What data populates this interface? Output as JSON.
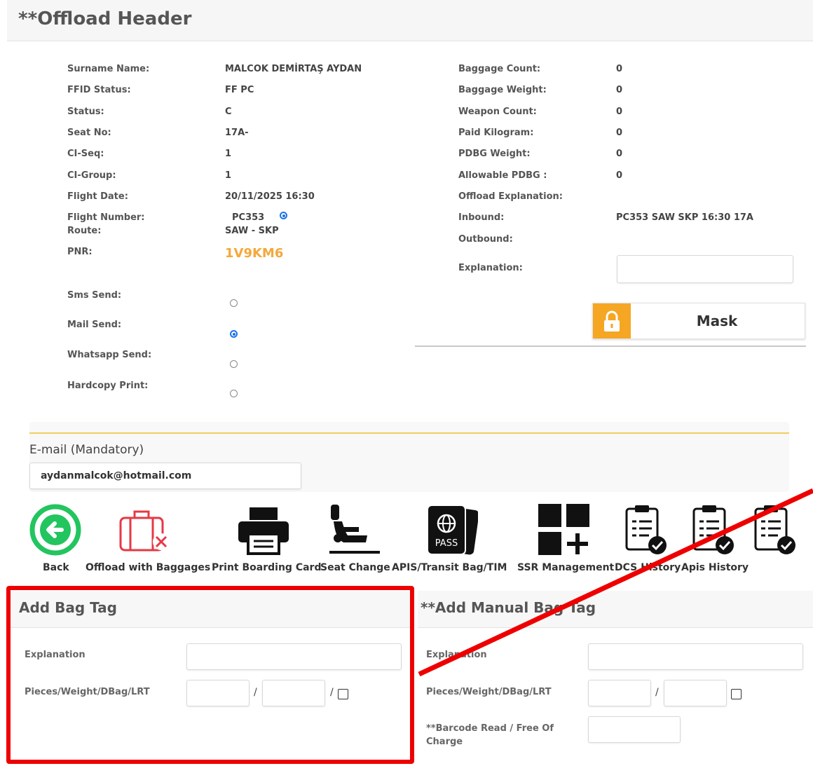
{
  "header": {
    "title": "**Offload Header"
  },
  "passenger_left": [
    {
      "label": "Surname Name:",
      "value": "MALCOK DEMİRTAŞ AYDAN"
    },
    {
      "label": "FFID Status:",
      "value": "FF PC"
    },
    {
      "label": "Status:",
      "value": "C"
    },
    {
      "label": "Seat No:",
      "value": "17A-"
    },
    {
      "label": "CI-Seq:",
      "value": "1"
    },
    {
      "label": "CI-Group:",
      "value": "1"
    },
    {
      "label": "Flight Date:",
      "value": "20/11/2025 16:30"
    },
    {
      "label": "Flight Number:",
      "value": "PC353"
    },
    {
      "label": "Route:",
      "value": "SAW - SKP"
    },
    {
      "label": "PNR:",
      "value": "1V9KM6"
    }
  ],
  "passenger_right": [
    {
      "label": "Baggage Count:",
      "value": "0"
    },
    {
      "label": "Baggage Weight:",
      "value": "0"
    },
    {
      "label": "Weapon Count:",
      "value": "0"
    },
    {
      "label": "Paid Kilogram:",
      "value": "0"
    },
    {
      "label": "PDBG Weight:",
      "value": "0"
    },
    {
      "label": "Allowable PDBG :",
      "value": "0"
    },
    {
      "label": "Offload Explanation:",
      "value": ""
    },
    {
      "label": "Inbound:",
      "value": "PC353 SAW SKP 16:30 17A"
    },
    {
      "label": "Outbound:",
      "value": ""
    },
    {
      "label": "Explanation:",
      "value": ""
    }
  ],
  "notifications": [
    {
      "label": "Sms Send:",
      "selected": false
    },
    {
      "label": "Mail Send:",
      "selected": true
    },
    {
      "label": "Whatsapp Send:",
      "selected": false
    },
    {
      "label": "Hardcopy Print:",
      "selected": false
    }
  ],
  "mask_button": {
    "label": "Mask"
  },
  "email": {
    "label": "E-mail (Mandatory)",
    "value": "aydanmalcok@hotmail.com"
  },
  "actions": [
    {
      "label": "Back",
      "icon": "back-arrow-icon"
    },
    {
      "label": "Offload with Baggages",
      "icon": "luggage-remove-icon"
    },
    {
      "label": "Print Boarding Card",
      "icon": "printer-icon"
    },
    {
      "label": "Seat Change",
      "icon": "seat-icon"
    },
    {
      "label": "APIS/Transit Bag/TIM",
      "icon": "passport-icon"
    },
    {
      "label": "SSR Management",
      "icon": "grid-add-icon"
    },
    {
      "label": "DCS History",
      "icon": "clipboard-check-icon"
    },
    {
      "label": "Apis History",
      "icon": "clipboard-check-icon"
    }
  ],
  "add_bag_tag": {
    "title": "Add Bag Tag",
    "explanation_label": "Explanation",
    "pieces_label": "Pieces/Weight/DBag/LRT"
  },
  "add_manual_bag_tag": {
    "title": "**Add Manual Bag Tag",
    "explanation_label": "Explanation",
    "pieces_label": "Pieces/Weight/DBag/LRT",
    "barcode_label_1": "**Barcode Read / Free Of",
    "barcode_label_2": "Charge"
  },
  "colors": {
    "pnr": "#f4a83a",
    "accent": "#1a73e8",
    "lock": "#f5a623",
    "highlight": "#ee0000"
  }
}
